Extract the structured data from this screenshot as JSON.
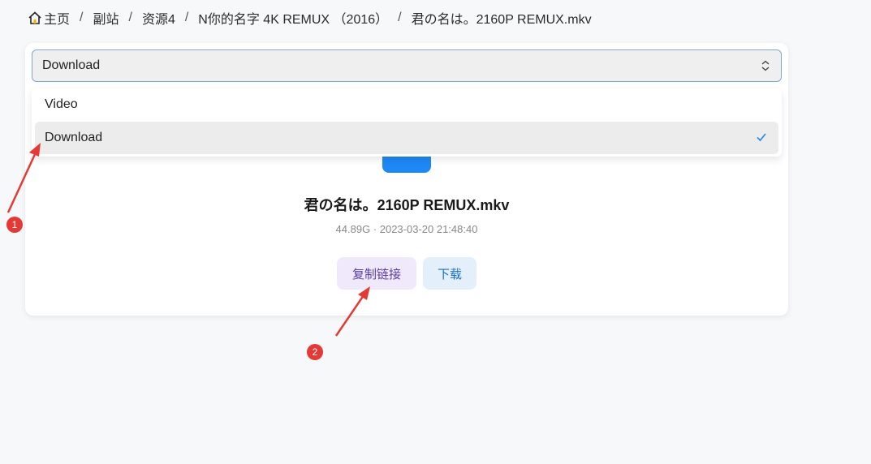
{
  "breadcrumb": {
    "items": [
      "主页",
      "副站",
      "资源4",
      "N你的名字 4K REMUX （2016）",
      "君の名は。2160P REMUX.mkv"
    ],
    "separator": "/"
  },
  "select": {
    "value": "Download",
    "options": [
      "Video",
      "Download"
    ]
  },
  "file": {
    "name": "君の名は。2160P REMUX.mkv",
    "meta": "44.89G · 2023-03-20 21:48:40"
  },
  "actions": {
    "copy_link": "复制链接",
    "download": "下载"
  },
  "annotations": {
    "marker1": "1",
    "marker2": "2"
  },
  "colors": {
    "accent": "#1e88f5",
    "marker": "#e53935",
    "check": "#1e88f5"
  }
}
